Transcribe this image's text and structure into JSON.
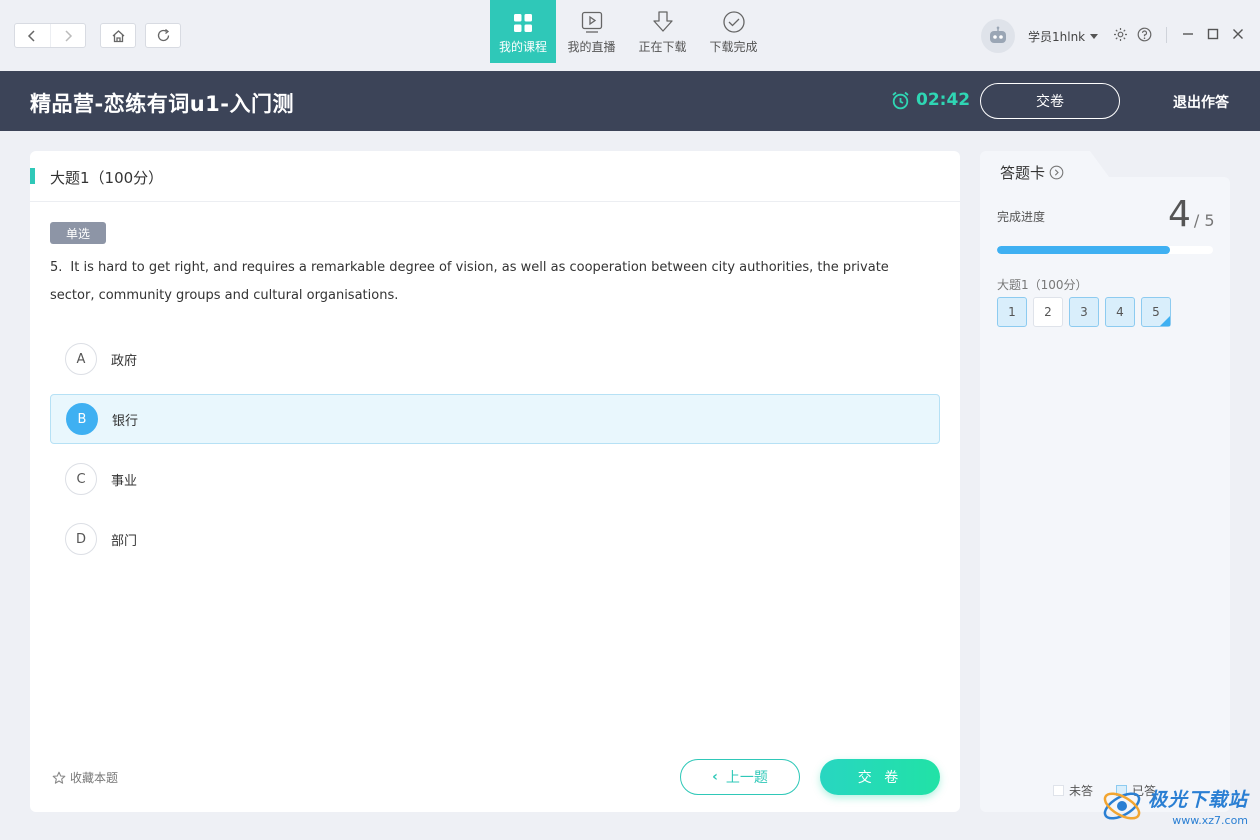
{
  "topbar": {
    "tabs": [
      {
        "label": "我的课程",
        "icon": "grid-icon",
        "active": true
      },
      {
        "label": "我的直播",
        "icon": "play-icon",
        "active": false
      },
      {
        "label": "正在下载",
        "icon": "download-icon",
        "active": false
      },
      {
        "label": "下载完成",
        "icon": "check-circle-icon",
        "active": false
      }
    ],
    "user_name": "学员1hlnk"
  },
  "header": {
    "title": "精品营-恋练有词u1-入门测",
    "timer": "02:42",
    "submit_label": "交卷",
    "exit_label": "退出作答"
  },
  "question": {
    "section_title": "大题1（100分）",
    "type_label": "单选",
    "number": "5.",
    "text": "It is hard to get right, and requires a remarkable degree of vision, as well as cooperation between city authorities, the private sector, community groups and cultural organisations.",
    "options": [
      {
        "letter": "A",
        "text": "政府",
        "selected": false
      },
      {
        "letter": "B",
        "text": "银行",
        "selected": true
      },
      {
        "letter": "C",
        "text": "事业",
        "selected": false
      },
      {
        "letter": "D",
        "text": "部门",
        "selected": false
      }
    ],
    "favorite_label": "收藏本题",
    "prev_label": "上一题",
    "submit_label": "交 卷"
  },
  "answer_card": {
    "title": "答题卡",
    "progress_label": "完成进度",
    "completed": "4",
    "total": "/ 5",
    "progress_fraction": 0.8,
    "section_label": "大题1（100分）",
    "cells": [
      {
        "n": "1",
        "answered": true,
        "current": false
      },
      {
        "n": "2",
        "answered": false,
        "current": false
      },
      {
        "n": "3",
        "answered": true,
        "current": false
      },
      {
        "n": "4",
        "answered": true,
        "current": false
      },
      {
        "n": "5",
        "answered": true,
        "current": true
      }
    ],
    "legend_unanswered": "未答",
    "legend_answered": "已答"
  },
  "watermark": {
    "name": "极光下载站",
    "url": "www.xz7.com"
  },
  "colors": {
    "accent_teal": "#2fc8b8",
    "accent_blue": "#3fb0f2",
    "header_bg": "#3c4458",
    "timer_green": "#2fd6b4"
  }
}
